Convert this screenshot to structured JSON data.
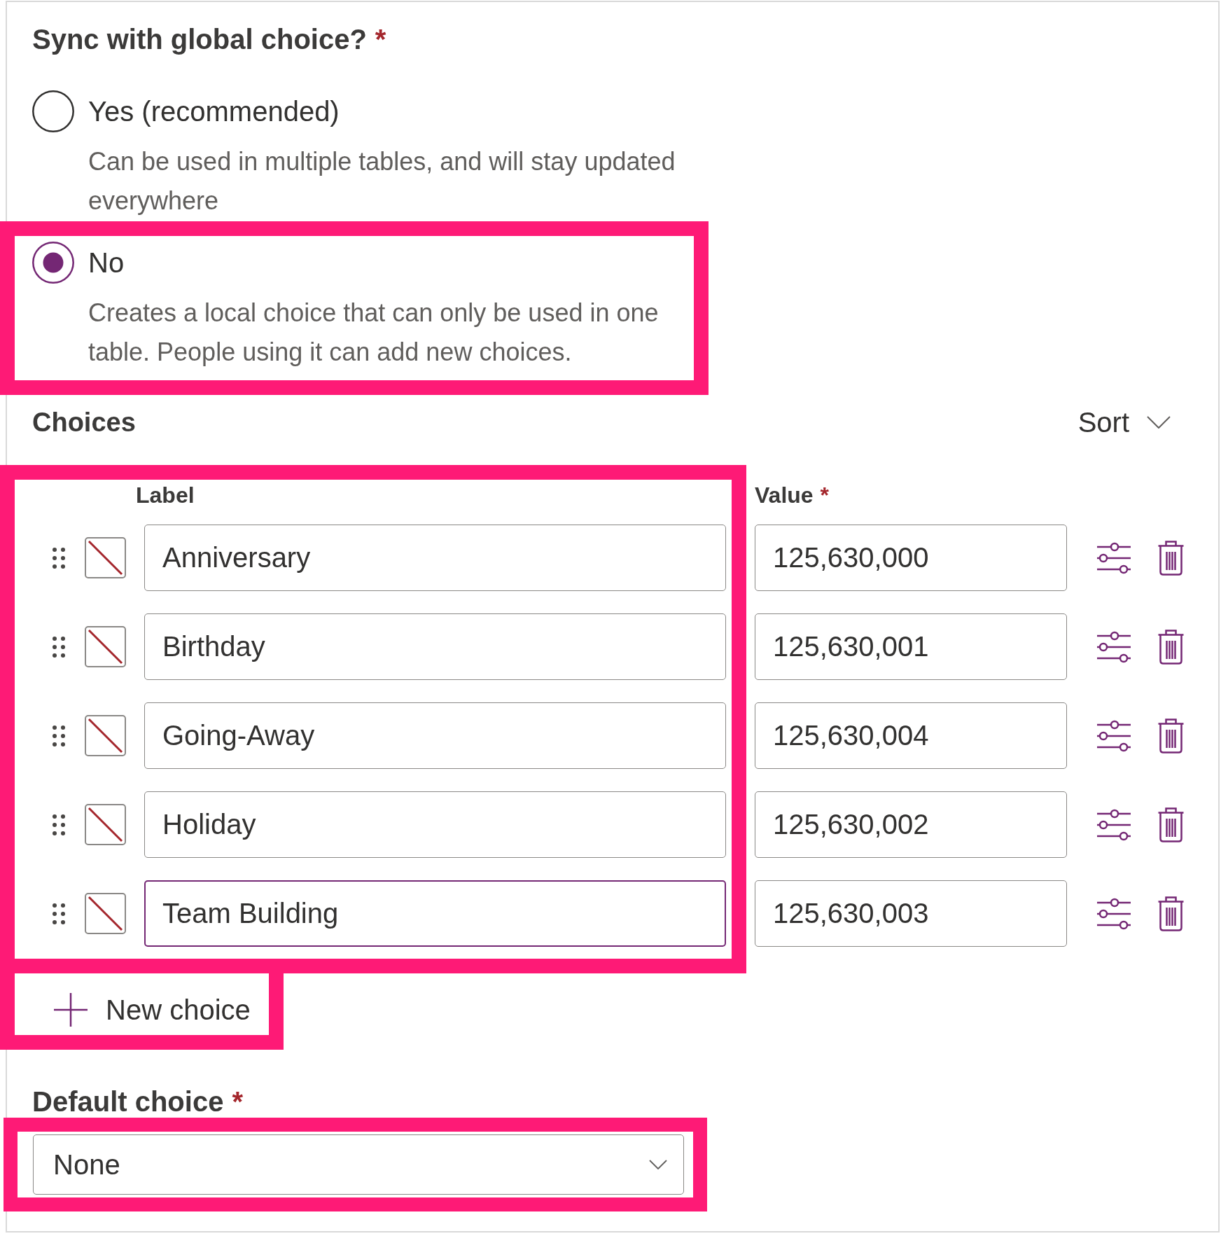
{
  "sync_setting": {
    "label": "Sync with global choice?",
    "required_mark": "*",
    "options": [
      {
        "label": "Yes (recommended)",
        "description": "Can be used in multiple tables, and will stay updated everywhere",
        "selected": false,
        "highlighted": false
      },
      {
        "label": "No",
        "description": "Creates a local choice that can only be used in one table. People using it can add new choices.",
        "selected": true,
        "highlighted": true
      }
    ]
  },
  "choices": {
    "title": "Choices",
    "sort_button": {
      "label": "Sort"
    },
    "highlighted": true,
    "columns": [
      {
        "label": "Label"
      },
      {
        "label": "Value",
        "required_mark": "*"
      }
    ],
    "rows": [
      {
        "label": "Anniversary",
        "value": "125,630,000",
        "focused": false
      },
      {
        "label": "Birthday",
        "value": "125,630,001",
        "focused": false
      },
      {
        "label": "Going-Away",
        "value": "125,630,004",
        "focused": false
      },
      {
        "label": "Holiday",
        "value": "125,630,002",
        "focused": false
      },
      {
        "label": "Team Building",
        "value": "125,630,003",
        "focused": true
      }
    ]
  },
  "new_choice_button": {
    "label": "New choice",
    "highlighted": true
  },
  "default_choice": {
    "label": "Default choice",
    "required_mark": "*",
    "value": "None",
    "highlighted": true
  }
}
